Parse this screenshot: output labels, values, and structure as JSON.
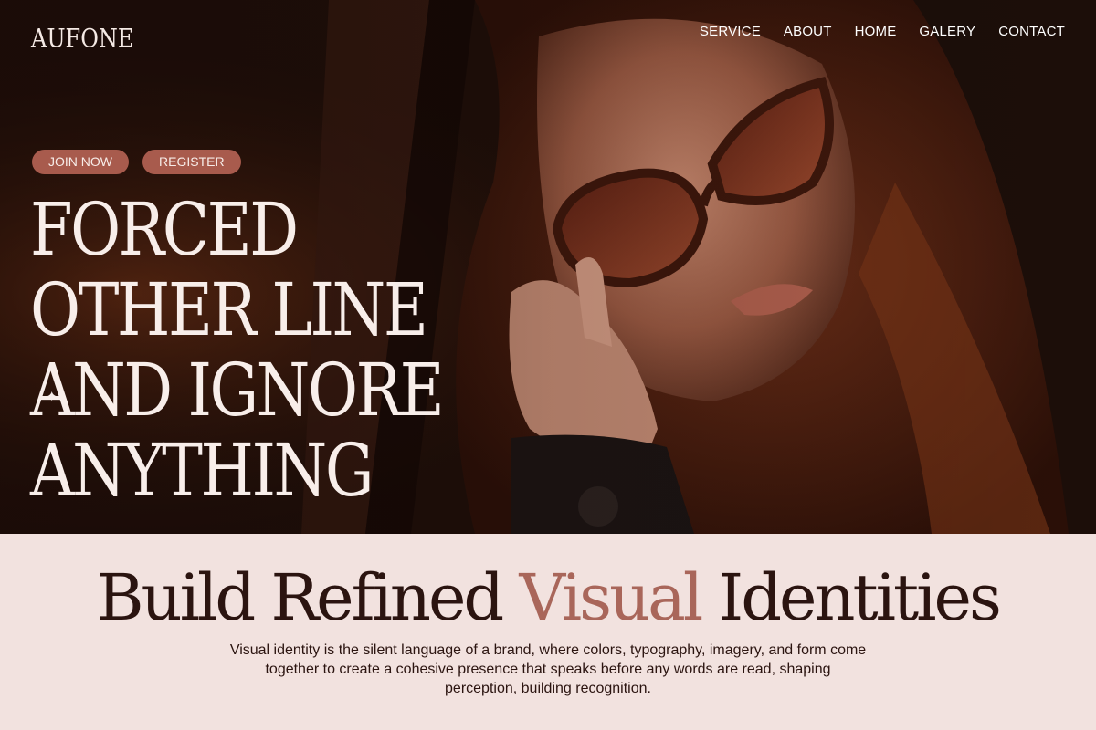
{
  "brand": {
    "logo_text": "AUFONE"
  },
  "nav": {
    "items": [
      {
        "label": "SERVICE"
      },
      {
        "label": "ABOUT"
      },
      {
        "label": "HOME"
      },
      {
        "label": "GALERY"
      },
      {
        "label": "CONTACT"
      }
    ]
  },
  "hero": {
    "join_label": "JOIN NOW",
    "register_label": "REGISTER",
    "headline_lines": [
      "FORCED",
      "OTHER LINE",
      "AND IGNORE",
      "ANYTHING"
    ],
    "sparkle_glyph": "✦",
    "image": "woman-with-sunglasses-photo"
  },
  "section": {
    "title_part1": "Build Refined ",
    "title_accent": "Visual",
    "title_part2": " Identities",
    "body": "Visual identity is the silent language of a brand, where colors, typography, imagery, and form come together to create a cohesive presence that speaks before any words are read, shaping perception, building recognition."
  },
  "colors": {
    "accent": "#a85b4d",
    "title_accent": "#a9665a",
    "section_bg": "#f2e2df",
    "dark_text": "#2b1410",
    "hero_text": "#f8eeea"
  }
}
